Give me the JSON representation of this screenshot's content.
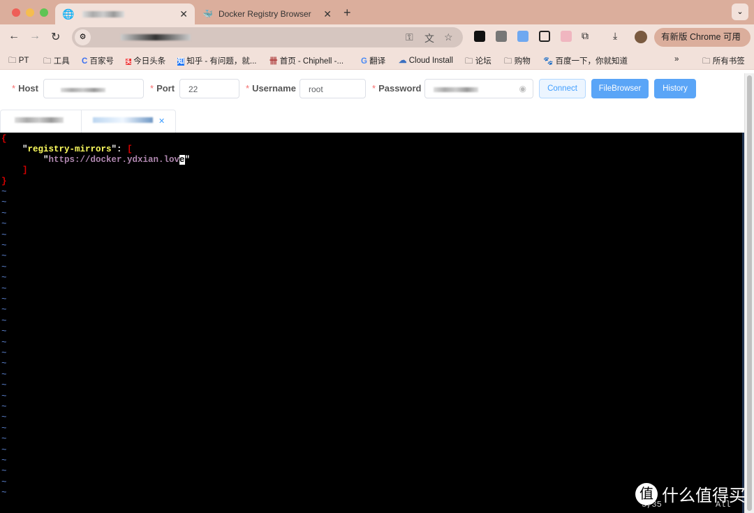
{
  "browser": {
    "tabs": [
      {
        "label": ""
      },
      {
        "label": "Docker Registry Browser"
      }
    ],
    "update_button": "有新版 Chrome 可用",
    "bookmarks": [
      "PT",
      "工具",
      "百家号",
      "今日头条",
      "知乎 - 有问题，就...",
      "首页 - Chiphell -...",
      "翻译",
      "Cloud Install",
      "论坛",
      "购物",
      "百度一下，你就知道"
    ],
    "all_bookmarks": "所有书签"
  },
  "form": {
    "host_label": "Host",
    "port_label": "Port",
    "port_value": "22",
    "username_label": "Username",
    "username_value": "root",
    "password_label": "Password",
    "connect": "Connect",
    "filebrowser": "FileBrowser",
    "history": "History"
  },
  "editor": {
    "lines": [
      "{",
      "    \"registry-mirrors\": [",
      "        \"https://docker.ydxian.love\"",
      "    ]",
      "}"
    ],
    "key": "registry-mirrors",
    "url_before_cursor": "https://docker.ydxian.lov",
    "cursor_char": "e",
    "position": "3,35",
    "scroll": "All"
  },
  "watermark": {
    "icon": "值",
    "text": "什么值得买"
  },
  "colors": {
    "primary": "#409eff",
    "required": "#f56c6c",
    "json_key": "#ffff5f",
    "json_string": "#af87af",
    "json_bracket": "#d70000",
    "tilde": "#5f87d7"
  }
}
